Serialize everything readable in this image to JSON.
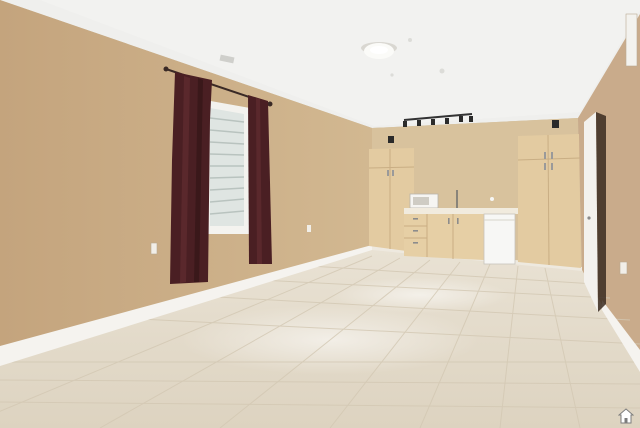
{
  "image": {
    "kind": "photograph",
    "subject": "empty-room-interior"
  },
  "colors": {
    "wall_left": "#c9ab86",
    "wall_back": "#d6bf9a",
    "wall_right": "#c7a98a",
    "ceiling": "#eeeeec",
    "floor": "#e7dfd0",
    "cabinet": "#e6cfa5",
    "curtain": "#4a1e22",
    "baseboard": "#f4f2ee",
    "window_blind": "#e9ecea"
  },
  "watermark": {
    "icon": "house-icon"
  }
}
